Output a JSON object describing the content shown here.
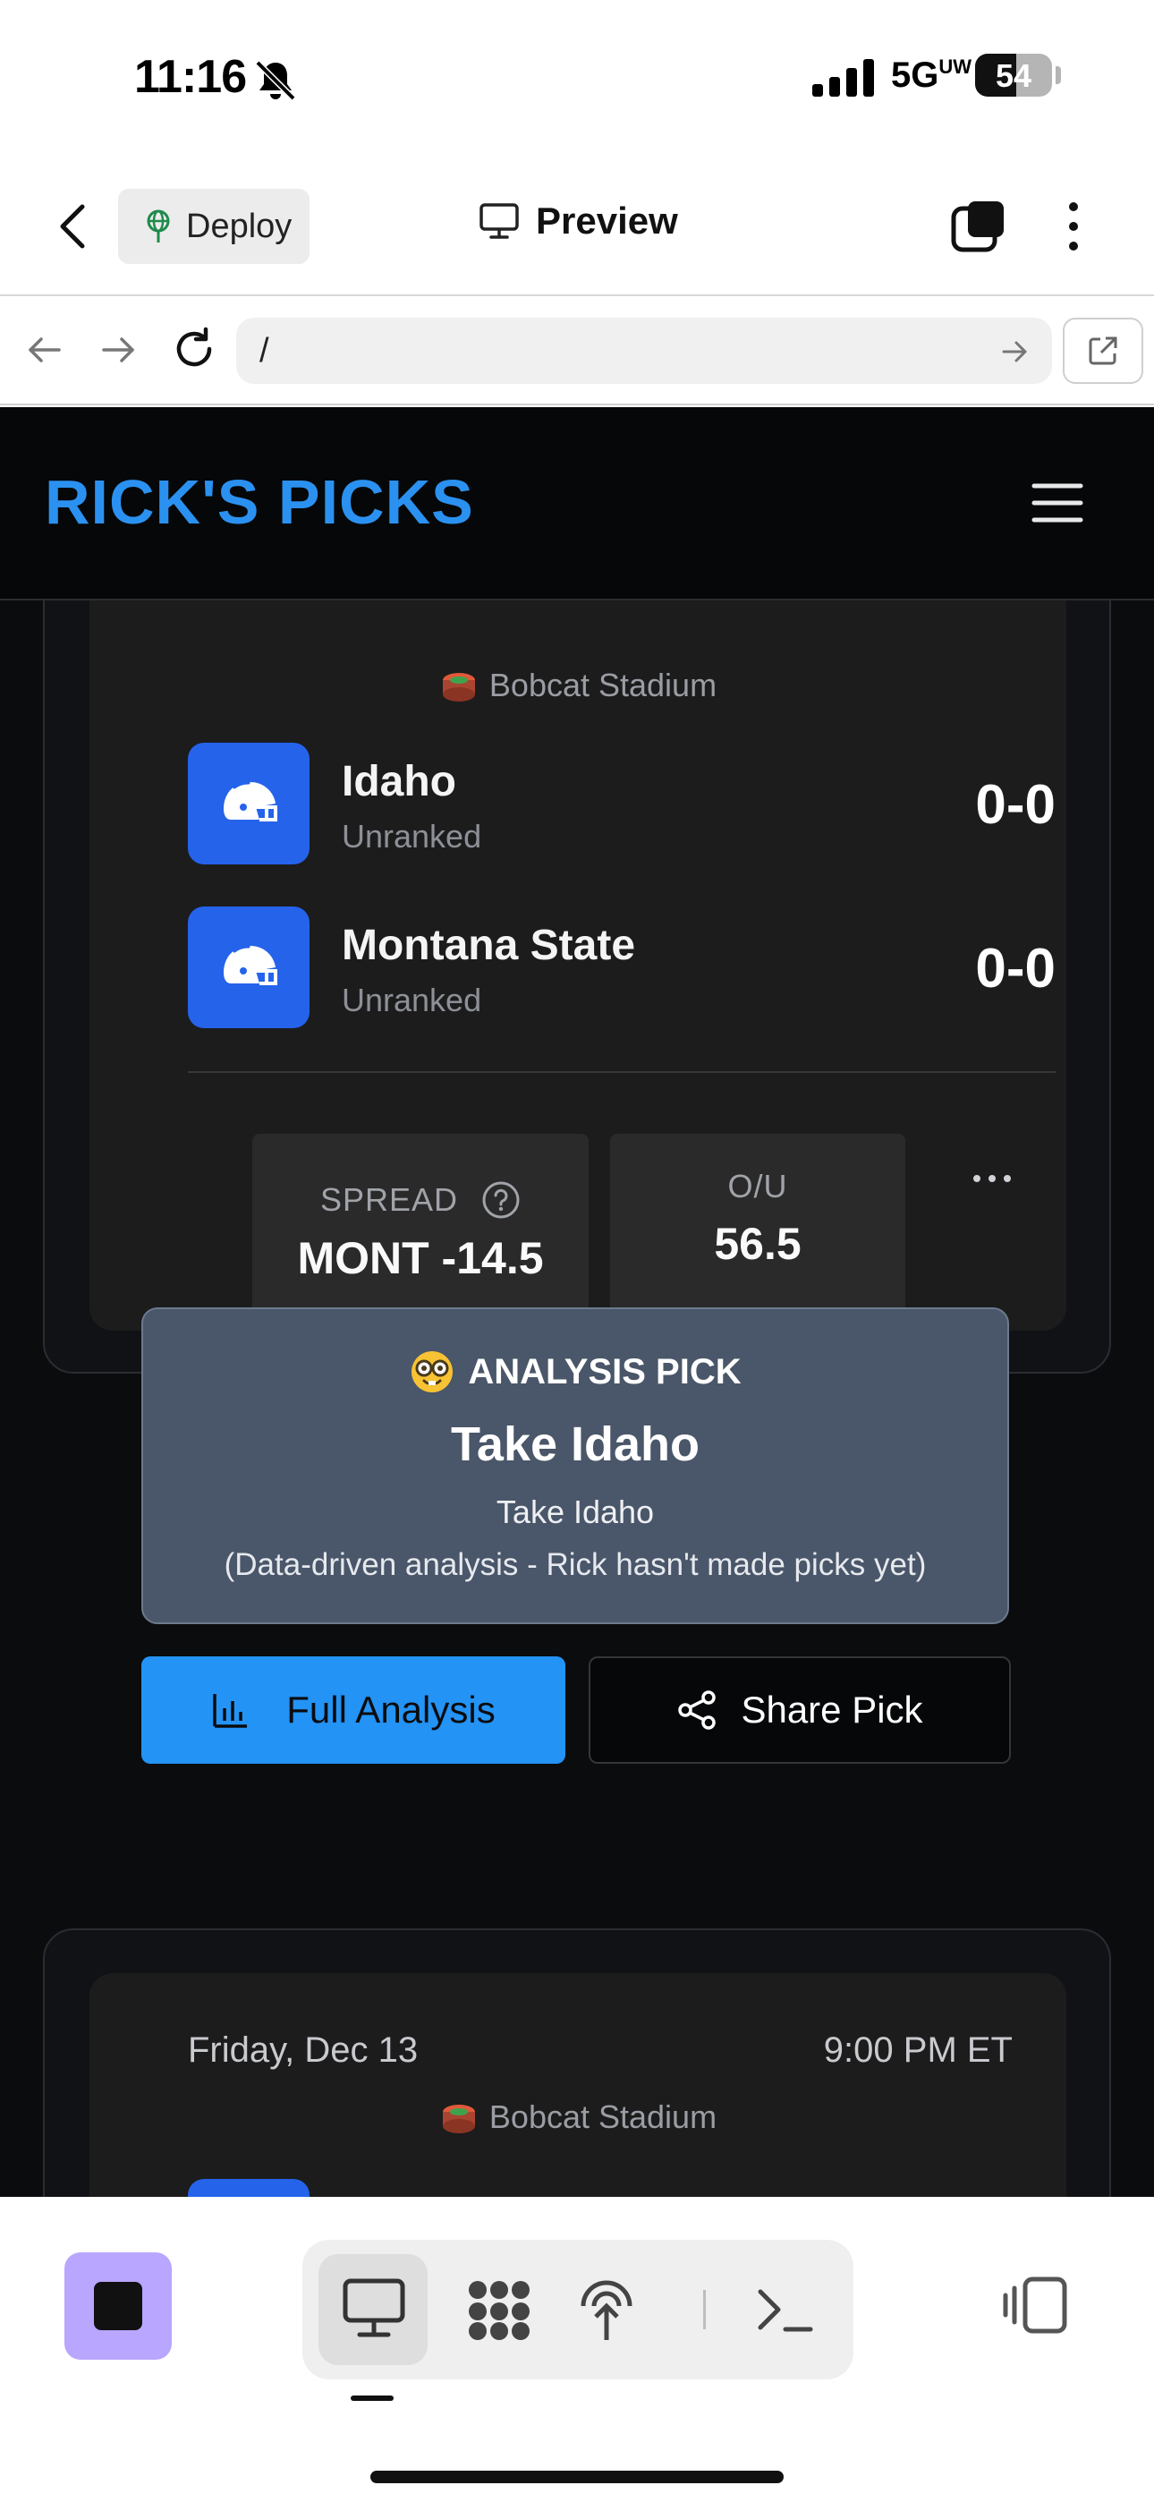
{
  "status_bar": {
    "time": "11:16",
    "network": "5G",
    "network_suffix": "UW",
    "battery": "54",
    "battery_level": 0.54
  },
  "app_header": {
    "deploy_label": "Deploy",
    "title": "Preview"
  },
  "url_bar": {
    "value": "/"
  },
  "site": {
    "logo": "RICK'S PICKS"
  },
  "games": [
    {
      "stadium": "Bobcat Stadium",
      "teams": [
        {
          "name": "Idaho",
          "rank": "Unranked",
          "record": "0-0"
        },
        {
          "name": "Montana State",
          "rank": "Unranked",
          "record": "0-0"
        }
      ],
      "spread_label": "SPREAD",
      "spread_value": "MONT -14.5",
      "ou_label": "O/U",
      "ou_value": "56.5",
      "pick_tag": "ANALYSIS PICK",
      "pick_title": "Take Idaho",
      "pick_sub": "Take Idaho",
      "pick_note": "(Data-driven analysis - Rick hasn't made picks yet)",
      "btn_analysis": "Full Analysis",
      "btn_share": "Share Pick"
    },
    {
      "date": "Friday, Dec 13",
      "time": "9:00 PM ET",
      "stadium": "Bobcat Stadium"
    }
  ],
  "icons": {
    "accent": "#2393f5",
    "team_logo_bg": "#2563eb",
    "stop_button_bg": "#b9a6ff"
  }
}
